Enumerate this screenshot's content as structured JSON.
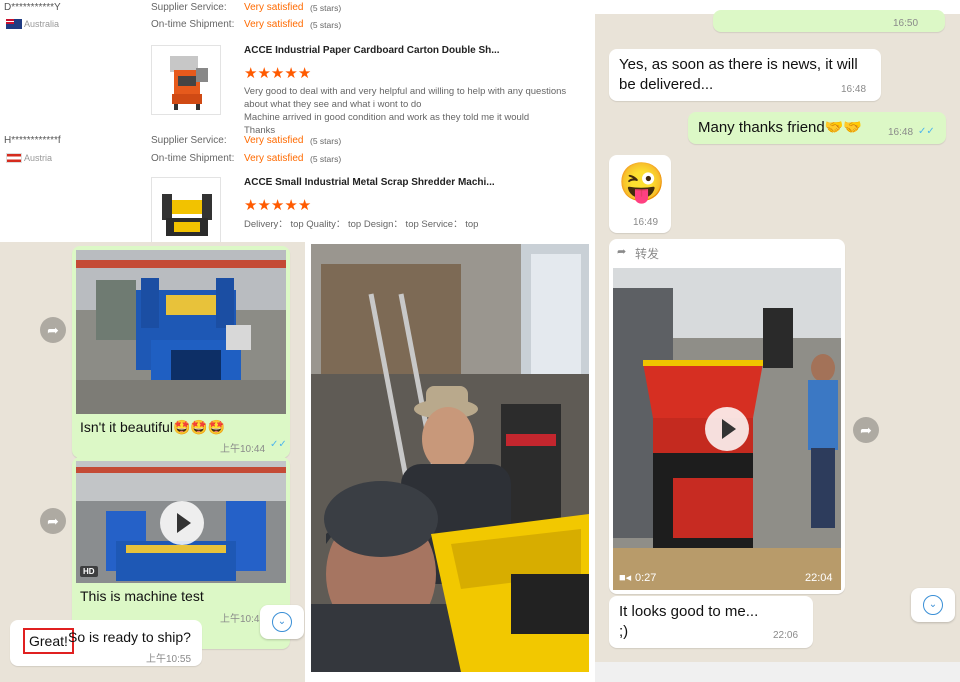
{
  "reviews": [
    {
      "name": "D***********Y",
      "country": "Australia",
      "supplier_service_label": "Supplier Service:",
      "supplier_service_value": "Very satisfied",
      "supplier_service_stars": "(5 stars)",
      "ontime_label": "On-time Shipment:",
      "ontime_value": "Very satisfied",
      "ontime_stars": "(5 stars)",
      "product_title": "ACCE Industrial Paper Cardboard Carton Double Sh...",
      "rating": 5,
      "text": "Very good to deal with and very helpful and willing to help with any questions about what they see and what i wont to do\nMachine arrived in good condition and work as they told me it would\nThanks"
    },
    {
      "name": "H************f",
      "country": "Austria",
      "supplier_service_label": "Supplier Service:",
      "supplier_service_value": "Very satisfied",
      "supplier_service_stars": "(5 stars)",
      "ontime_label": "On-time Shipment:",
      "ontime_value": "Very satisfied",
      "ontime_stars": "(5 stars)",
      "product_title": "ACCE Small Industrial Metal Scrap Shredder Machi...",
      "rating": 5,
      "text": "Delivery： top Quality： top Design： top Service： top"
    }
  ],
  "chat_left": {
    "msg1_text": "Isn't it beautiful🤩🤩🤩",
    "msg1_time": "上午10:44",
    "msg2_badge": "HD",
    "msg2_text": "This is machine test",
    "msg2_time": "上午10:45",
    "msg3_highlight": "Great!",
    "msg3_text": " So is ready to ship?",
    "msg3_time": "上午10:55"
  },
  "chat_right": {
    "top_time": "16:50",
    "msg1_text": "Yes, as soon as there is news, it will be delivered...",
    "msg1_time": "16:48",
    "msg2_text": "Many thanks friend🤝🤝",
    "msg2_time": "16:48",
    "msg3_emoji": "😜",
    "msg3_time": "16:49",
    "forward_label": "转发",
    "video_duration": "0:27",
    "video_time": "22:04",
    "msg4_text": "It looks good to me...\n;)",
    "msg4_time": "22:06"
  },
  "colors": {
    "accent_orange": "#ff6a00",
    "star_orange": "#ff5a00",
    "bubble_out": "#dcf8c6",
    "bubble_in": "#ffffff",
    "chat_bg": "#e9e3d8",
    "read_ticks": "#4fb6ec",
    "highlight_box": "#e02020"
  }
}
